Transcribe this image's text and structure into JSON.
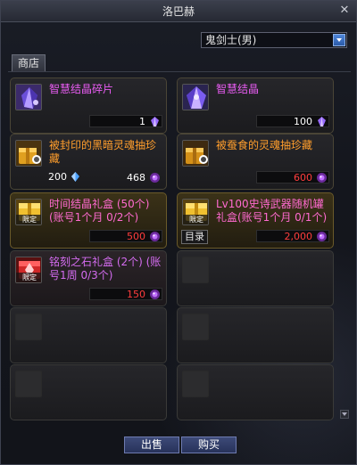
{
  "window": {
    "title": "洛巴赫",
    "close_symbol": "✕"
  },
  "job_selector": {
    "value": "鬼剑士(男)"
  },
  "tabs": {
    "shop": "商店"
  },
  "items": [
    {
      "name": "智慧结晶碎片",
      "price": "1",
      "name_color": "#e85cf2",
      "icon": "crystal-shard-icon",
      "currency_icon": "purple-crystal-icon"
    },
    {
      "name": "智慧结晶",
      "price": "100",
      "name_color": "#e85cf2",
      "icon": "wisdom-crystal-icon",
      "currency_icon": "purple-crystal-icon"
    },
    {
      "name": "被封印的黑暗灵魂抽珍藏",
      "price_secondary": "200",
      "price": "468",
      "name_color": "#ff9e2c",
      "icon": "sealed-box-icon",
      "currency_icon": "soul-icon",
      "secondary_currency_icon": "blue-crystal-icon"
    },
    {
      "name": "被蚕食的灵魂抽珍藏",
      "price": "600",
      "price_red": true,
      "name_color": "#ff9e2c",
      "icon": "devoured-box-icon",
      "currency_icon": "soul-icon"
    },
    {
      "name": "时间结晶礼盒 (50个) (账号1个月 0/2个)",
      "price": "500",
      "price_red": true,
      "name_color": "#ff6ad0",
      "icon": "time-crystal-box-icon",
      "limit_label": "限定",
      "currency_icon": "soul-icon"
    },
    {
      "name": "Lv100史诗武器随机罐礼盒(账号1个月 0/1个)",
      "price": "2,000",
      "price_red": true,
      "name_color": "#ff6ad0",
      "icon": "epic-weapon-box-icon",
      "limit_label": "限定",
      "catalog_label": "目录",
      "currency_icon": "soul-icon"
    },
    {
      "name": "铭刻之石礼盒 (2个) (账号1周 0/3个)",
      "price": "150",
      "price_red": true,
      "name_color": "#d46cf0",
      "icon": "inscription-stone-box-icon",
      "limit_label": "限定",
      "currency_icon": "soul-icon"
    }
  ],
  "buttons": {
    "sell": "出售",
    "buy": "购买"
  },
  "colors": {
    "name_purple": "#e85cf2",
    "name_orange": "#ff9e2c",
    "name_pink": "#ff6ad0",
    "price_red": "#ff3d3d",
    "button_blue": "#3d4a78"
  }
}
